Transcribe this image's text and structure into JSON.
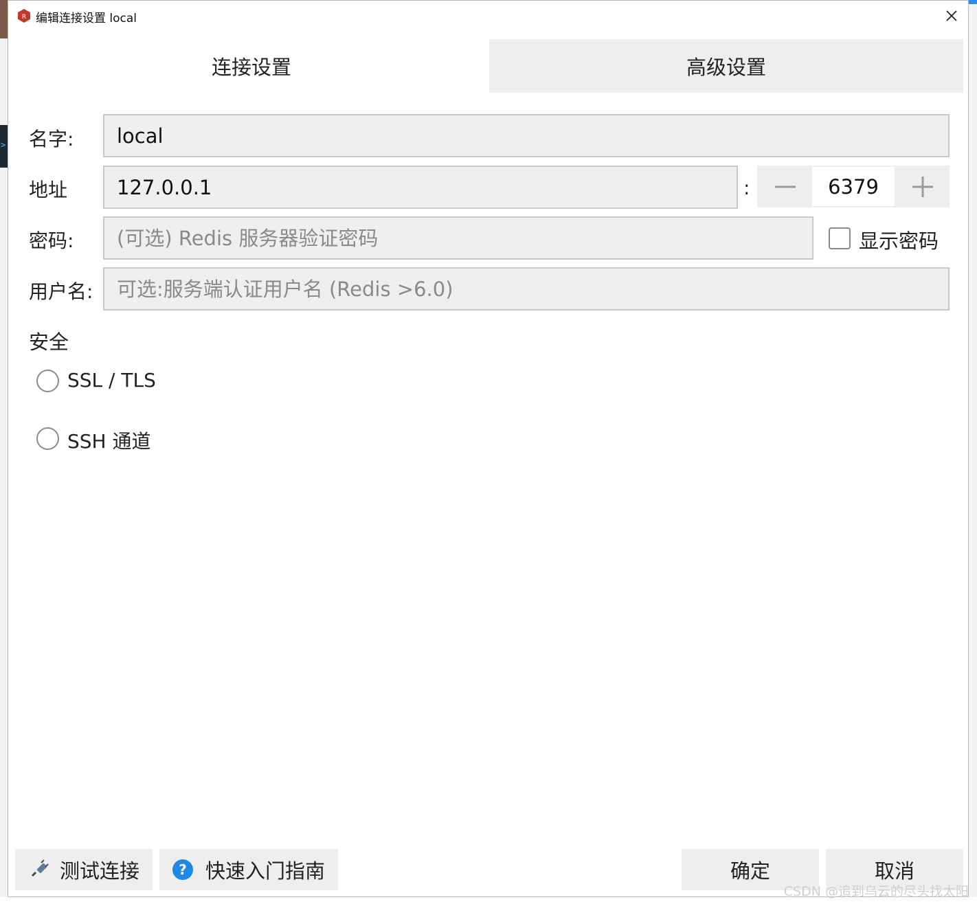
{
  "window": {
    "title": "编辑连接设置 local",
    "close_label": "×"
  },
  "tabs": [
    {
      "label": "连接设置",
      "active": true
    },
    {
      "label": "高级设置",
      "active": false
    }
  ],
  "form": {
    "name_label": "名字:",
    "name_value": "local",
    "address_label": "地址",
    "address_value": "127.0.0.1",
    "port_separator": ":",
    "port_value": "6379",
    "password_label": "密码:",
    "password_placeholder": "(可选) Redis 服务器验证密码",
    "show_password_label": "显示密码",
    "username_label": "用户名:",
    "username_placeholder": "可选:服务端认证用户名 (Redis >6.0)"
  },
  "security": {
    "title": "安全",
    "options": [
      {
        "label": "SSL / TLS",
        "selected": false
      },
      {
        "label": "SSH 通道",
        "selected": false
      }
    ]
  },
  "footer": {
    "test_label": "测试连接",
    "guide_label": "快速入门指南",
    "ok_label": "确定",
    "cancel_label": "取消"
  },
  "watermark": "CSDN @追到乌云的尽头找太阳",
  "colors": {
    "accent": "#1e88e5",
    "app_icon": "#c0392b",
    "field_bg": "#efefef",
    "tab_inactive_bg": "#eeeeee"
  },
  "icons": {
    "app": "redis-logo-icon",
    "close": "close-icon",
    "test": "plug-icon",
    "guide": "question-circle-icon",
    "minus": "minus-icon",
    "plus": "plus-icon"
  }
}
